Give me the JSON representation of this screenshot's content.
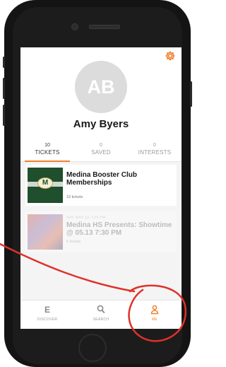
{
  "profile": {
    "initials": "AB",
    "name": "Amy Byers"
  },
  "tabs": [
    {
      "count": "10",
      "label": "TICKETS"
    },
    {
      "count": "0",
      "label": "SAVED"
    },
    {
      "count": "0",
      "label": "INTERESTS"
    }
  ],
  "tickets": [
    {
      "date": "",
      "title": "Medina Booster Club Memberships",
      "sub": "10 tickets",
      "badge": "M"
    },
    {
      "date": "SAT, MAY 13, 7:30 PM",
      "title": "Medina HS Presents: Showtime @ 05.13 7:30 PM",
      "sub": "5 tickets"
    }
  ],
  "nav": [
    {
      "icon": "E",
      "label": "DISCOVER"
    },
    {
      "icon": "⚲",
      "label": "SEARCH"
    },
    {
      "icon": "♙",
      "label": "ME"
    }
  ],
  "colors": {
    "accent": "#f07f2b",
    "annotation": "#e0312a",
    "avatar": "#dcdcdc"
  },
  "icons": [
    "gear-icon",
    "discover-icon",
    "search-icon",
    "person-icon"
  ]
}
